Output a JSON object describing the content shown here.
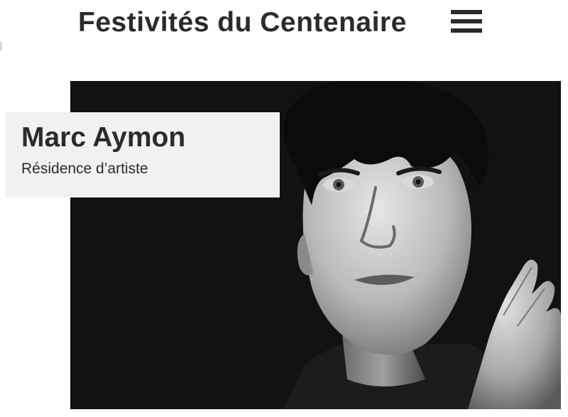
{
  "header": {
    "title": "Festivités du Centenaire",
    "menu_icon": "hamburger-menu-icon"
  },
  "hero": {
    "image_subject": "black-and-white portrait photograph",
    "background_color": "#121212"
  },
  "artist_card": {
    "name": "Marc Aymon",
    "role": "Résidence d’artiste",
    "background_color": "#f1f1f1"
  },
  "colors": {
    "text": "#2b2b2b",
    "page_background": "#ffffff"
  }
}
